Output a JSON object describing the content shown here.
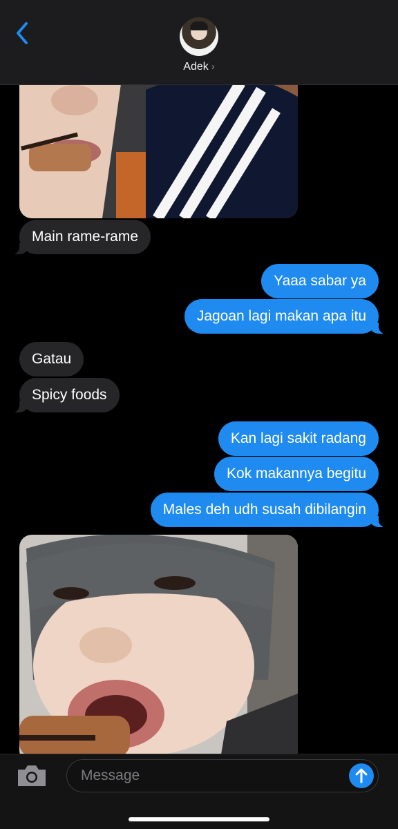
{
  "header": {
    "back_icon": "chevron-left-icon",
    "contact_name": "Adek",
    "contact_chevron": "›",
    "accent_color": "#1f8bf0"
  },
  "thread": {
    "messages": [
      {
        "type": "image",
        "direction": "incoming"
      },
      {
        "type": "text",
        "direction": "incoming",
        "text": "Main rame-rame"
      },
      {
        "type": "text",
        "direction": "outgoing",
        "text": "Yaaa sabar ya"
      },
      {
        "type": "text",
        "direction": "outgoing",
        "text": "Jagoan lagi makan apa itu"
      },
      {
        "type": "text",
        "direction": "incoming",
        "text": "Gatau"
      },
      {
        "type": "text",
        "direction": "incoming",
        "text": "Spicy foods"
      },
      {
        "type": "text",
        "direction": "outgoing",
        "text": "Kan lagi sakit radang"
      },
      {
        "type": "text",
        "direction": "outgoing",
        "text": "Kok makannya begitu"
      },
      {
        "type": "text",
        "direction": "outgoing",
        "text": "Males deh udh susah dibilangin"
      },
      {
        "type": "image",
        "direction": "incoming"
      }
    ]
  },
  "input_bar": {
    "camera_icon": "camera-icon",
    "placeholder": "Message",
    "send_icon": "arrow-up-icon"
  }
}
